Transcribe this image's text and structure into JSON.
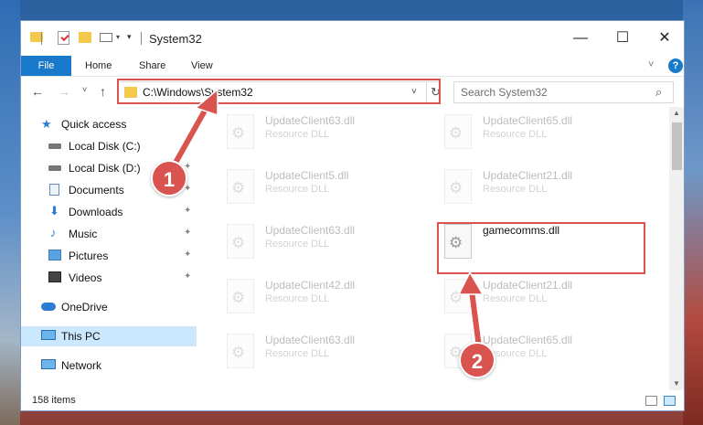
{
  "window": {
    "title": "System32",
    "minimize_glyph": "—",
    "maximize_glyph": "☐",
    "close_glyph": "✕"
  },
  "ribbon": {
    "tabs": [
      "File",
      "Home",
      "Share",
      "View"
    ],
    "help_label": "?"
  },
  "navigation": {
    "back_glyph": "←",
    "forward_glyph": "→",
    "recent_glyph": "˅",
    "up_glyph": "↑"
  },
  "address_bar": {
    "path": "C:\\Windows\\System32",
    "dropdown_glyph": "˅",
    "refresh_glyph": "↻"
  },
  "search": {
    "placeholder": "Search System32",
    "icon_glyph": "⌕"
  },
  "sidebar": {
    "items": [
      {
        "label": "Quick access",
        "icon": "star-icon",
        "pinned": false
      },
      {
        "label": "Local Disk (C:)",
        "icon": "drive-icon",
        "pinned": true
      },
      {
        "label": "Local Disk (D:)",
        "icon": "drive-icon",
        "pinned": true
      },
      {
        "label": "Documents",
        "icon": "documents-icon",
        "pinned": true
      },
      {
        "label": "Downloads",
        "icon": "downloads-icon",
        "pinned": true
      },
      {
        "label": "Music",
        "icon": "music-icon",
        "pinned": true
      },
      {
        "label": "Pictures",
        "icon": "pictures-icon",
        "pinned": true
      },
      {
        "label": "Videos",
        "icon": "videos-icon",
        "pinned": true
      },
      {
        "label": "OneDrive",
        "icon": "cloud-icon",
        "pinned": false
      },
      {
        "label": "This PC",
        "icon": "computer-icon",
        "pinned": false,
        "selected": true
      },
      {
        "label": "Network",
        "icon": "network-icon",
        "pinned": false
      }
    ],
    "pin_glyph": "📌"
  },
  "files": [
    {
      "name": "UpdateClient63.dll",
      "type": "Resource DLL",
      "faded": true
    },
    {
      "name": "UpdateClient65.dll",
      "type": "Resource DLL",
      "faded": true
    },
    {
      "name": "UpdateClient5.dll",
      "type": "Resource DLL",
      "faded": true
    },
    {
      "name": "UpdateClient21.dll",
      "type": "Resource DLL",
      "faded": true
    },
    {
      "name": "UpdateClient63.dll",
      "type": "Resource DLL",
      "faded": true
    },
    {
      "name": "gamecomms.dll",
      "type": "",
      "faded": false
    },
    {
      "name": "UpdateClient42.dll",
      "type": "Resource DLL",
      "faded": true
    },
    {
      "name": "UpdateClient21.dll",
      "type": "Resource DLL",
      "faded": true
    },
    {
      "name": "UpdateClient63.dll",
      "type": "Resource DLL",
      "faded": true
    },
    {
      "name": "UpdateClient65.dll",
      "type": "Resource DLL",
      "faded": true
    }
  ],
  "status": {
    "item_count": "158 items"
  },
  "annotations": {
    "step1": "1",
    "step2": "2",
    "color": "#d9534f"
  }
}
